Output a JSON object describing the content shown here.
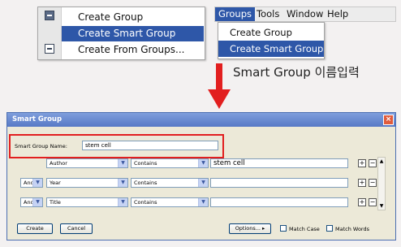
{
  "context_menu": {
    "items": [
      {
        "label": "Create Group",
        "selected": false
      },
      {
        "label": "Create Smart Group",
        "selected": true
      },
      {
        "label": "Create From Groups...",
        "selected": false
      }
    ]
  },
  "menubar": {
    "items": [
      "Groups",
      "Tools",
      "Window",
      "Help"
    ],
    "active": "Groups",
    "dropdown": [
      {
        "label": "Create Group",
        "selected": false
      },
      {
        "label": "Create Smart Group",
        "selected": true
      }
    ]
  },
  "caption": "Smart Group 이름입력",
  "dialog": {
    "title": "Smart Group",
    "close": "×",
    "name_label": "Smart Group Name:",
    "name_value": "stem cell",
    "rows": [
      {
        "op": "",
        "field": "Author",
        "condition": "Contains",
        "value": "stem cell"
      },
      {
        "op": "And",
        "field": "Year",
        "condition": "Contains",
        "value": ""
      },
      {
        "op": "And",
        "field": "Title",
        "condition": "Contains",
        "value": ""
      }
    ],
    "plus": "+",
    "minus": "−",
    "create_label": "Create",
    "cancel_label": "Cancel",
    "options_label": "Options... ▸",
    "match_case_label": "Match Case",
    "match_words_label": "Match Words"
  },
  "colors": {
    "highlight": "#2e57a8",
    "annotation_red": "#e21f1f"
  }
}
